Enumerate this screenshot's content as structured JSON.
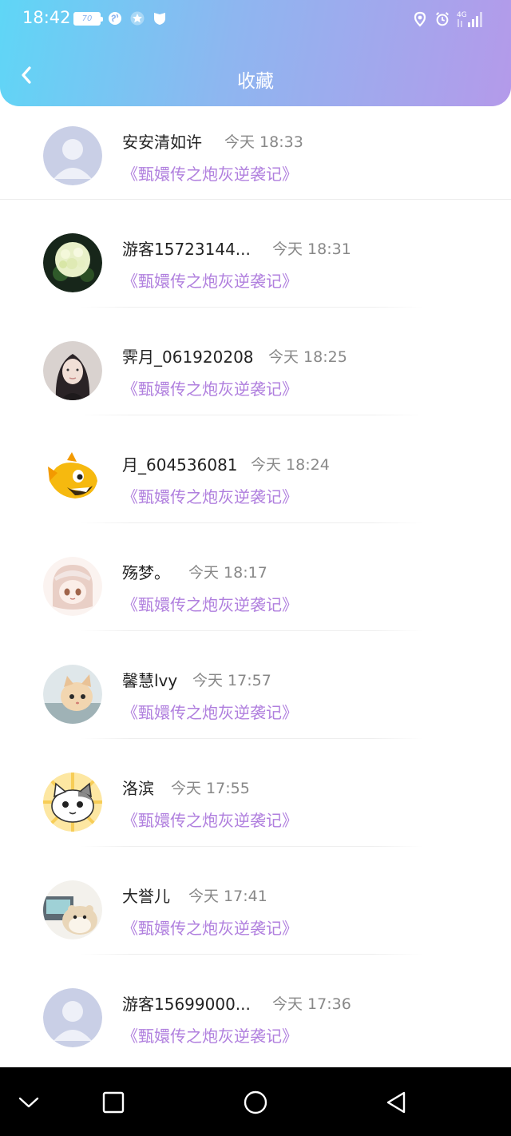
{
  "status_bar": {
    "time": "18:42",
    "battery": "70",
    "network": "4G"
  },
  "header": {
    "title": "收藏"
  },
  "favorites": [
    {
      "name": "安安清如许",
      "time": "今天 18:33",
      "book": "《甄嬛传之炮灰逆袭记》",
      "avatar": "default-avatar"
    },
    {
      "name": "游客15723144...",
      "time": "今天 18:31",
      "book": "《甄嬛传之炮灰逆袭记》",
      "avatar": "hydrangea-photo"
    },
    {
      "name": "霁月_061920208",
      "time": "今天 18:25",
      "book": "《甄嬛传之炮灰逆袭记》",
      "avatar": "girl-photo"
    },
    {
      "name": "月_604536081",
      "time": "今天 18:24",
      "book": "《甄嬛传之炮灰逆袭记》",
      "avatar": "yellow-cartoon-fish"
    },
    {
      "name": "殇梦。",
      "time": "今天 18:17",
      "book": "《甄嬛传之炮灰逆袭记》",
      "avatar": "anime-girl"
    },
    {
      "name": "馨慧lvy",
      "time": "今天 17:57",
      "book": "《甄嬛传之炮灰逆袭记》",
      "avatar": "kitten-photo"
    },
    {
      "name": "洛滨",
      "time": "今天 17:55",
      "book": "《甄嬛传之炮灰逆袭记》",
      "avatar": "cartoon-cat"
    },
    {
      "name": "大誉儿",
      "time": "今天 17:41",
      "book": "《甄嬛传之炮灰逆袭记》",
      "avatar": "hamster"
    },
    {
      "name": "游客15699000...",
      "time": "今天 17:36",
      "book": "《甄嬛传之炮灰逆袭记》",
      "avatar": "default-avatar"
    }
  ],
  "colors": {
    "header_gradient_start": "#5fd6f6",
    "header_gradient_end": "#b49aea",
    "book_title": "#b07fde",
    "time_text": "#888888"
  }
}
